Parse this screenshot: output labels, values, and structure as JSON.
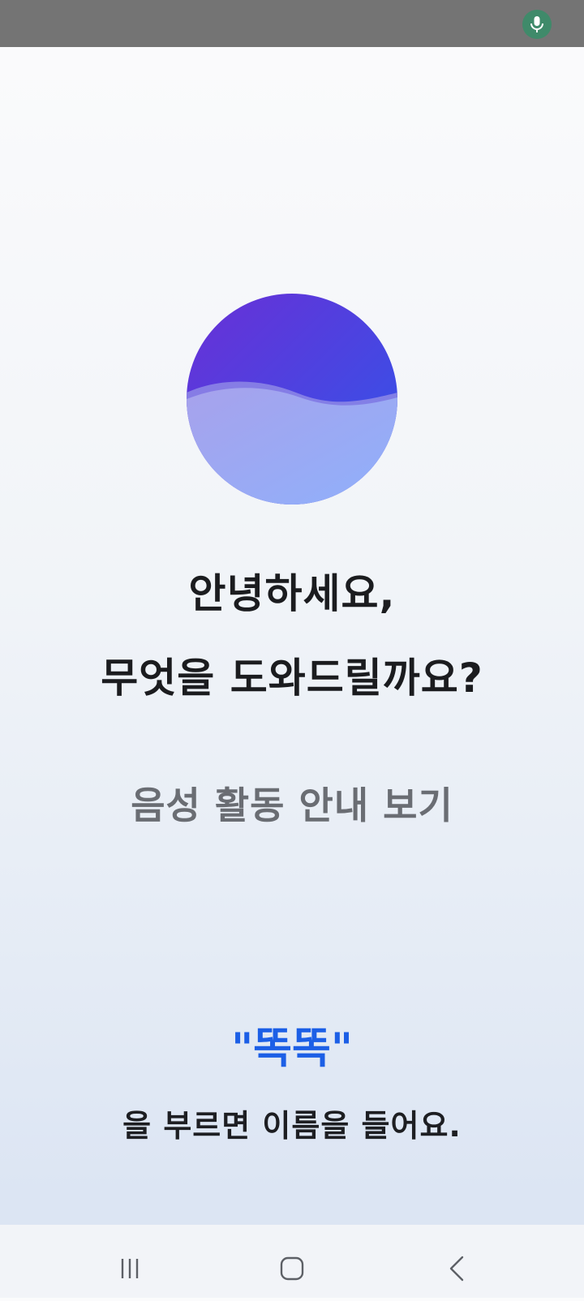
{
  "status_bar": {
    "mic_icon": "microphone-icon",
    "mic_color": "#3f8a6a"
  },
  "assistant": {
    "orb_icon": "assistant-orb",
    "greeting_line1": "안녕하세요,",
    "greeting_line2": "무엇을 도와드릴까요?",
    "guide_link": "음성 활동 안내 보기",
    "wake_word": "\"똑똑\"",
    "wake_hint": "을 부르면 이름을 들어요.",
    "accent_color": "#1c5fe6"
  },
  "nav_bar": {
    "recents_icon": "recents-icon",
    "home_icon": "home-icon",
    "back_icon": "back-icon"
  }
}
